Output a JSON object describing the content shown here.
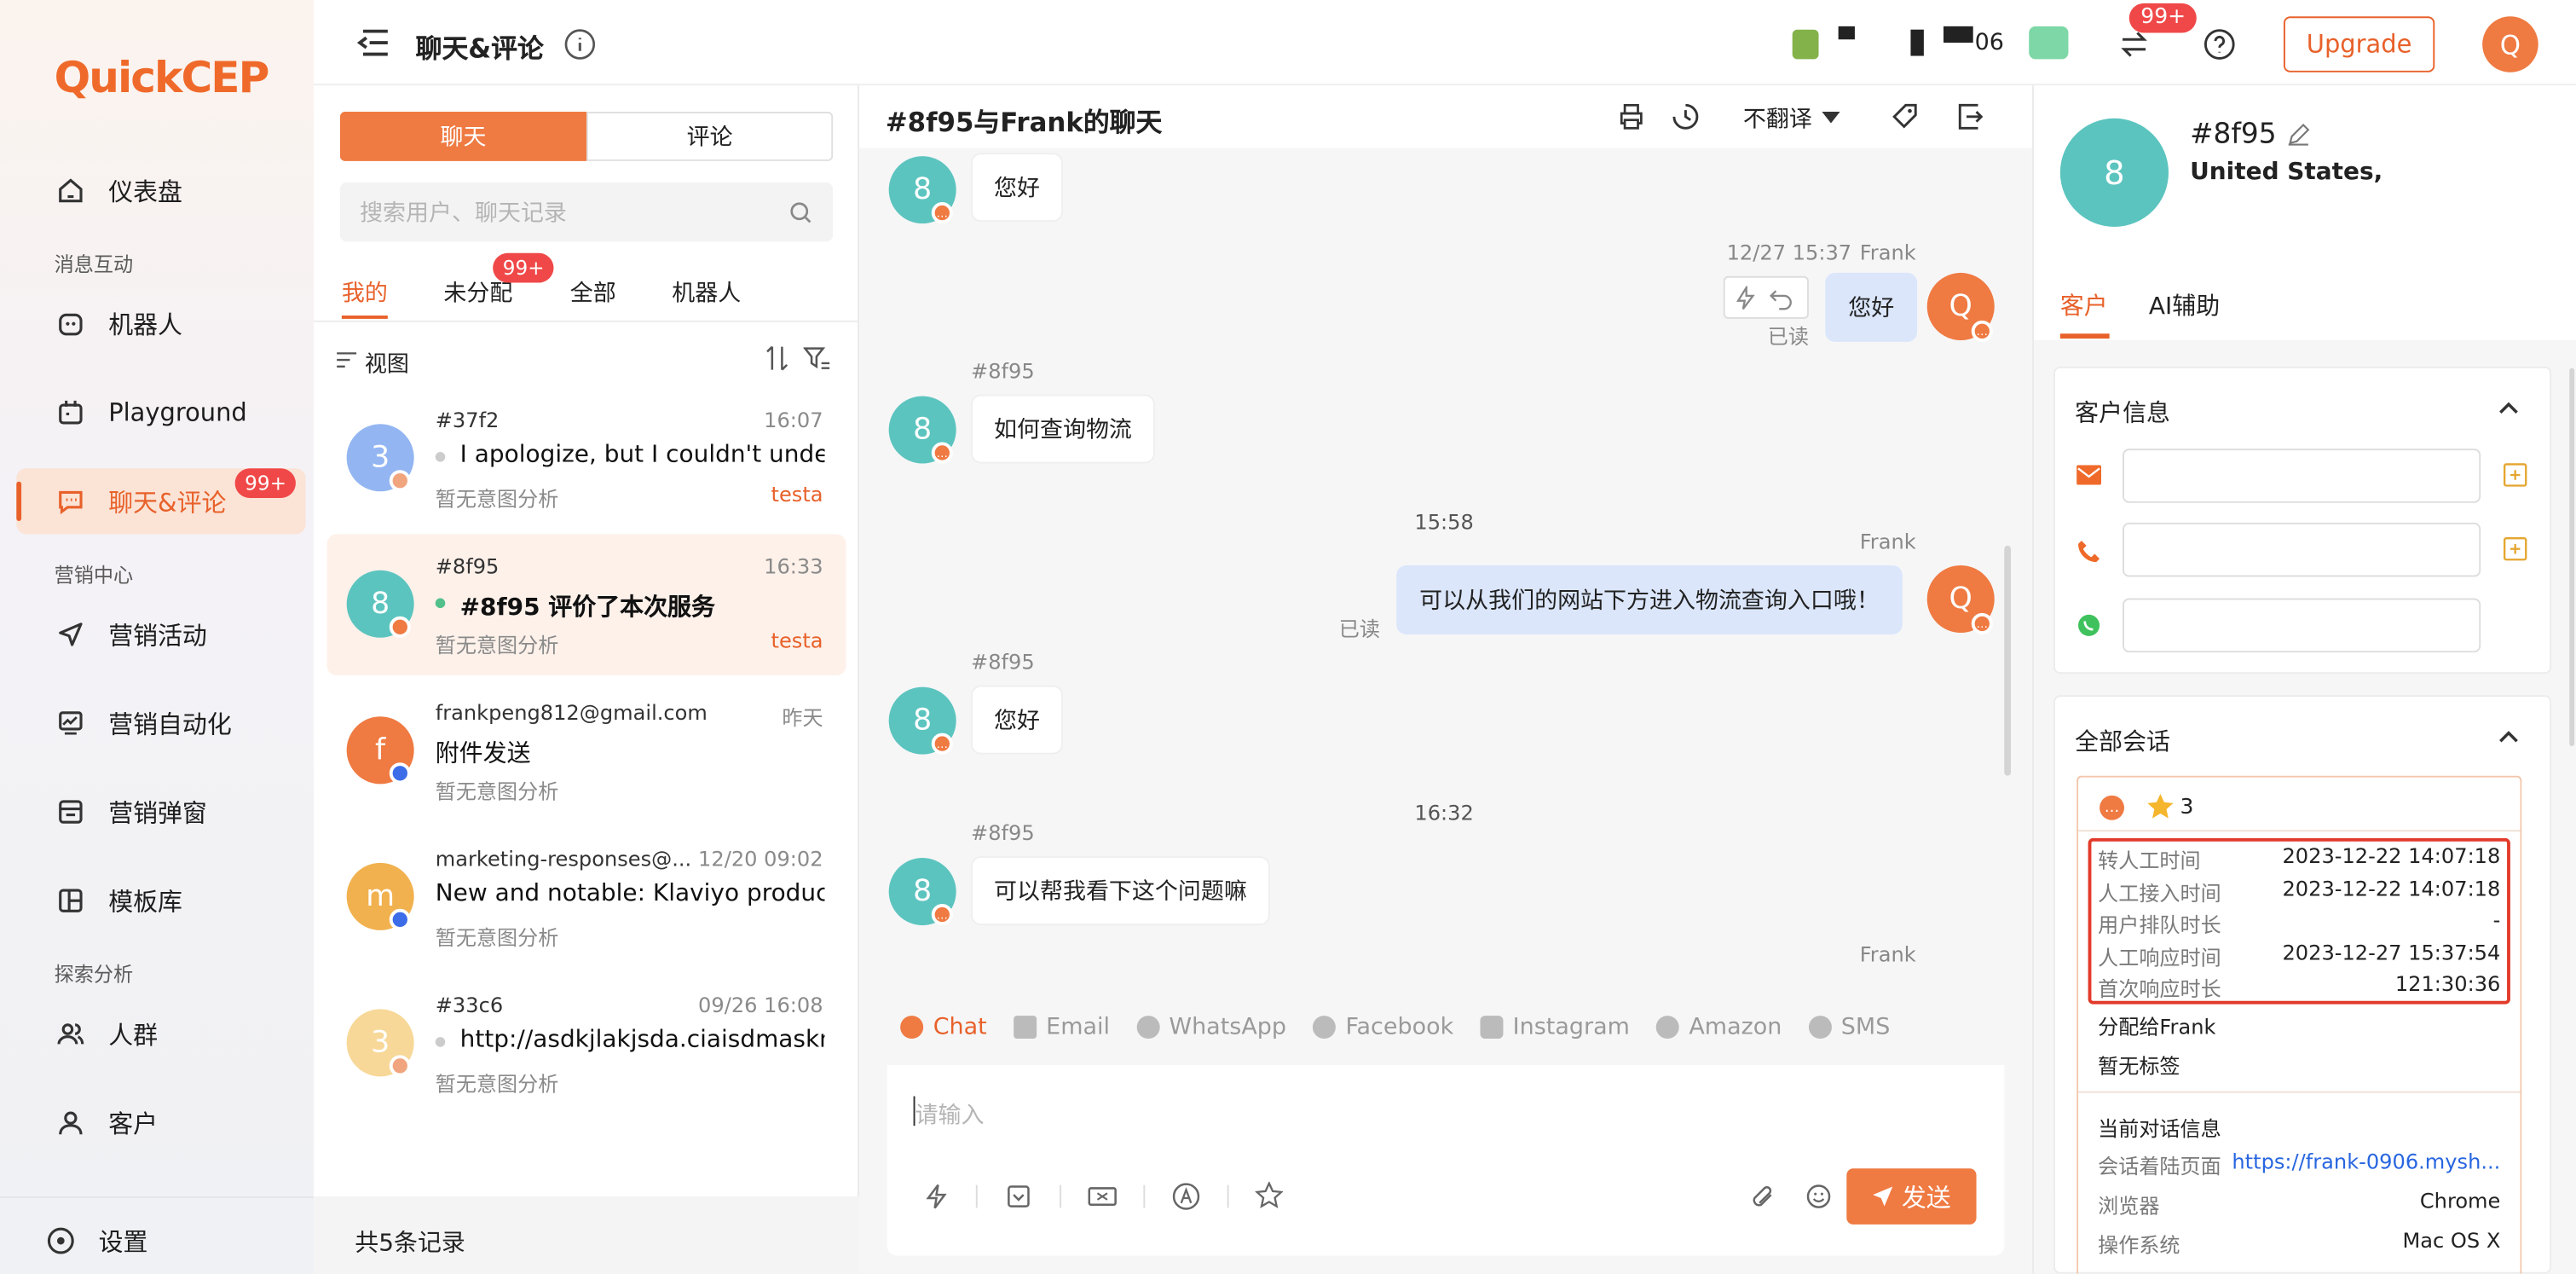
{
  "sidebar": {
    "logo": "QuickCEP",
    "items": [
      {
        "label": "仪表盘",
        "icon": "home-icon"
      },
      {
        "label": "机器人",
        "icon": "robot-icon"
      },
      {
        "label": "Playground",
        "icon": "playground-icon"
      },
      {
        "label": "聊天&评论",
        "icon": "chat-icon",
        "badge": "99+",
        "active": true
      },
      {
        "label": "营销活动",
        "icon": "send-icon"
      },
      {
        "label": "营销自动化",
        "icon": "chart-monitor-icon"
      },
      {
        "label": "营销弹窗",
        "icon": "popup-icon"
      },
      {
        "label": "模板库",
        "icon": "template-icon"
      },
      {
        "label": "人群",
        "icon": "users-icon"
      },
      {
        "label": "客户",
        "icon": "user-icon"
      }
    ],
    "sections": [
      "消息互动",
      "营销中心",
      "探索分析"
    ],
    "settings_label": "设置"
  },
  "topbar": {
    "title": "聊天&评论",
    "account_fragment": "06",
    "notif_badge": "99+",
    "upgrade_label": "Upgrade",
    "avatar_letter": "Q"
  },
  "convlist": {
    "tabs": [
      "聊天",
      "评论"
    ],
    "search_placeholder": "搜索用户、聊天记录",
    "filters": [
      "我的",
      "未分配",
      "全部",
      "机器人"
    ],
    "unassigned_badge": "99+",
    "view_label": "视图",
    "footer": "共5条记录",
    "items": [
      {
        "name": "#37f2",
        "time": "16:07",
        "message": "I apologize, but I couldn't unders",
        "intent": "暂无意图分析",
        "tag": "testa",
        "avatar": "3",
        "color": "#93b6f2",
        "dot": "#ccc",
        "sub": "#f1a57e",
        "selected": false
      },
      {
        "name": "#8f95",
        "time": "16:33",
        "message": "#8f95 评价了本次服务",
        "intent": "暂无意图分析",
        "tag": "testa",
        "avatar": "8",
        "color": "#5cc4bf",
        "dot": "#52c08a",
        "sub": "#ef7a42",
        "selected": true
      },
      {
        "name": "frankpeng812@gmail.com",
        "time": "昨天",
        "message": "附件发送",
        "intent": "暂无意图分析",
        "tag": "",
        "avatar": "f",
        "color": "#ef7a42",
        "dot": "",
        "sub": "#3c6ce8",
        "selected": false
      },
      {
        "name": "marketing-responses@...",
        "time": "12/20 09:02",
        "message": "New and notable: Klaviyo product u",
        "intent": "暂无意图分析",
        "tag": "",
        "avatar": "m",
        "color": "#f1b14e",
        "dot": "",
        "sub": "#3c6ce8",
        "selected": false
      },
      {
        "name": "#33c6",
        "time": "09/26 16:08",
        "message": "http://asdkjlakjsda.ciaisdmasknk",
        "intent": "暂无意图分析",
        "tag": "",
        "avatar": "3",
        "color": "#f7d898",
        "dot": "#ccc",
        "sub": "#f1a57e",
        "selected": false
      }
    ]
  },
  "chat": {
    "title": "#8f95与Frank的聊天",
    "translate_label": "不翻译",
    "messages": {
      "m1": "您好",
      "m2_meta_time": "12/27 15:37",
      "m2_meta_agent": "Frank",
      "m2": "您好",
      "m2_read": "已读",
      "m3_sender": "#8f95",
      "m3": "如何查询物流",
      "divider1": "15:58",
      "m4_agent": "Frank",
      "m4": "可以从我们的网站下方进入物流查询入口哦！",
      "m4_read": "已读",
      "m5_sender": "#8f95",
      "m5": "您好",
      "m6_sender": "#8f95",
      "divider2": "16:32",
      "m6": "可以帮我看下这个问题嘛",
      "m7_agent": "Frank"
    },
    "avatar_8": "8",
    "avatar_q": "Q",
    "channels": [
      "Chat",
      "Email",
      "WhatsApp",
      "Facebook",
      "Instagram",
      "Amazon",
      "SMS"
    ],
    "input_placeholder": "请输入",
    "send_label": "发送"
  },
  "right": {
    "avatar": "8",
    "name": "#8f95",
    "location": "United States,",
    "tabs": [
      "客户",
      "AI辅助"
    ],
    "customer_info_title": "客户信息",
    "all_sessions_title": "全部会话",
    "rating": "3",
    "metrics": [
      {
        "k": "转人工时间",
        "v": "2023-12-22 14:07:18"
      },
      {
        "k": "人工接入时间",
        "v": "2023-12-22 14:07:18"
      },
      {
        "k": "用户排队时长",
        "v": "-"
      },
      {
        "k": "人工响应时间",
        "v": "2023-12-27 15:37:54"
      },
      {
        "k": "首次响应时长",
        "v": "121:30:36"
      }
    ],
    "assigned": "分配给Frank",
    "no_tag": "暂无标签",
    "current_info_title": "当前对话信息",
    "landing_k": "会话着陆页面",
    "landing_v": "https://frank-0906.mysh...",
    "browser_k": "浏览器",
    "browser_v": "Chrome",
    "os_k": "操作系统",
    "os_v": "Mac OS X"
  }
}
